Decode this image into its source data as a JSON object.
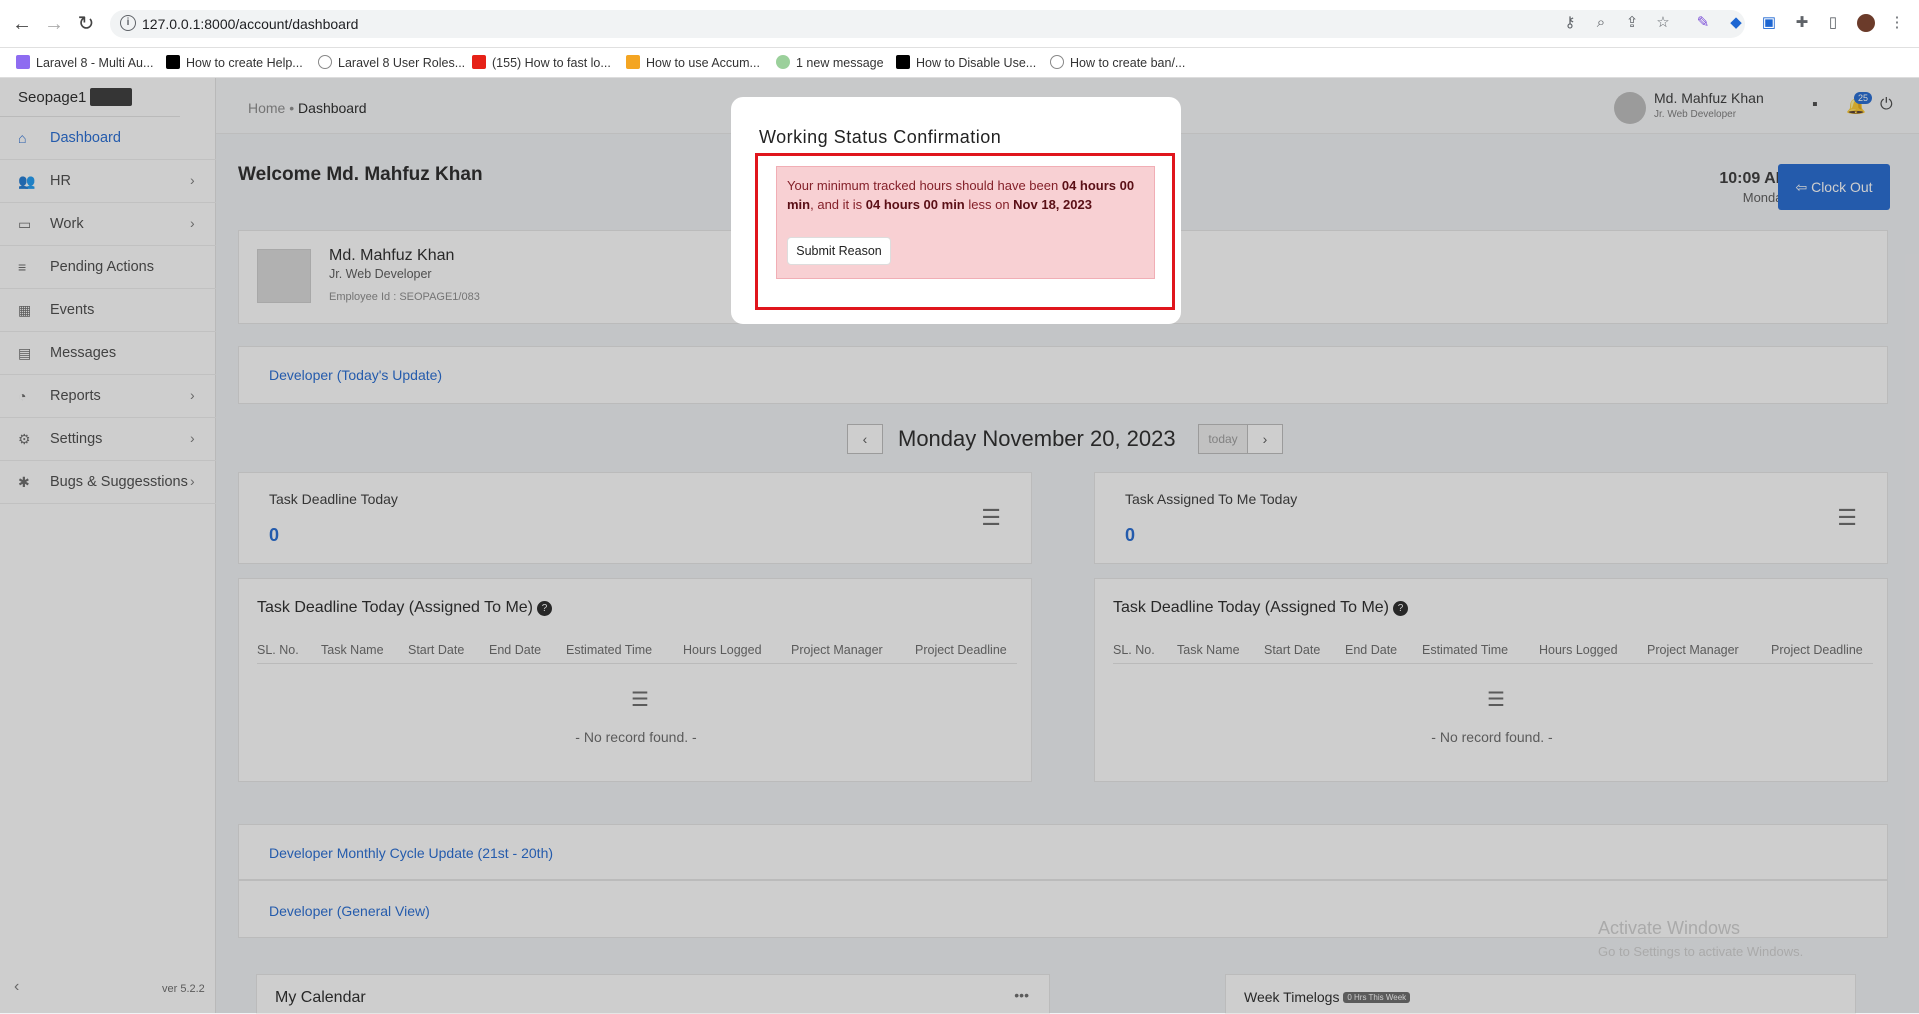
{
  "browser": {
    "url": "127.0.0.1:8000/account/dashboard",
    "bookmarks": [
      "Laravel 8 - Multi Au...",
      "How to create Help...",
      "Laravel 8 User Roles...",
      "(155) How to fast lo...",
      "How to use Accum...",
      "1 new message",
      "How to Disable Use...",
      "How to create ban/..."
    ]
  },
  "sidebar": {
    "brand": "Seopage1",
    "items": [
      {
        "label": "Dashboard",
        "icon": "home-icon"
      },
      {
        "label": "HR",
        "icon": "users-icon"
      },
      {
        "label": "Work",
        "icon": "briefcase-icon"
      },
      {
        "label": "Pending Actions",
        "icon": "document-icon"
      },
      {
        "label": "Events",
        "icon": "calendar-icon"
      },
      {
        "label": "Messages",
        "icon": "message-icon"
      },
      {
        "label": "Reports",
        "icon": "pie-chart-icon"
      },
      {
        "label": "Settings",
        "icon": "gear-icon"
      },
      {
        "label": "Bugs & Suggesstions",
        "icon": "bug-icon"
      }
    ],
    "version": "ver 5.2.2"
  },
  "topbar": {
    "crumb_home": "Home",
    "crumb_sep": " • ",
    "crumb_current": "Dashboard",
    "user_name": "Md. Mahfuz Khan",
    "user_role": "Jr. Web Developer",
    "notif_count": "25"
  },
  "welcome": {
    "title": "Welcome Md. Mahfuz Khan",
    "time": "10:09 AM",
    "day": "Monday",
    "clockout": "Clock Out"
  },
  "profile": {
    "name": "Md. Mahfuz Khan",
    "role": "Jr. Web Developer",
    "employee_id": "Employee Id : SEOPAGE1/083"
  },
  "sections": {
    "todays_update": "Developer (Today's Update)",
    "monthly_cycle": "Developer Monthly Cycle Update (21st - 20th)",
    "general_view": "Developer (General View)"
  },
  "daynav": {
    "date": "Monday November 20, 2023",
    "today": "today"
  },
  "cards": [
    {
      "title": "Task Deadline Today",
      "value": "0"
    },
    {
      "title": "Task Assigned To Me Today",
      "value": "0"
    }
  ],
  "tables": [
    {
      "title": "Task Deadline Today (Assigned To Me)"
    },
    {
      "title": "Task Deadline Today (Assigned To Me)"
    }
  ],
  "table_columns": [
    "SL. No.",
    "Task Name",
    "Start Date",
    "End Date",
    "Estimated Time",
    "Hours Logged",
    "Project Manager",
    "Project Deadline"
  ],
  "empty_text": "- No record found. -",
  "bottom": {
    "calendar": "My Calendar",
    "timelogs": "Week Timelogs",
    "timelogs_badge": "0 Hrs This Week"
  },
  "modal": {
    "title": "Working Status Confirmation",
    "msg_part1": "Your minimum tracked hours should have been ",
    "msg_bold1": "04 hours 00 min",
    "msg_part2": ", and it is ",
    "msg_bold2": "04 hours 00 min",
    "msg_part3": " less on ",
    "msg_bold3": "Nov 18, 2023",
    "submit": "Submit Reason"
  },
  "watermark": {
    "line1": "Activate Windows",
    "line2": "Go to Settings to activate Windows."
  }
}
